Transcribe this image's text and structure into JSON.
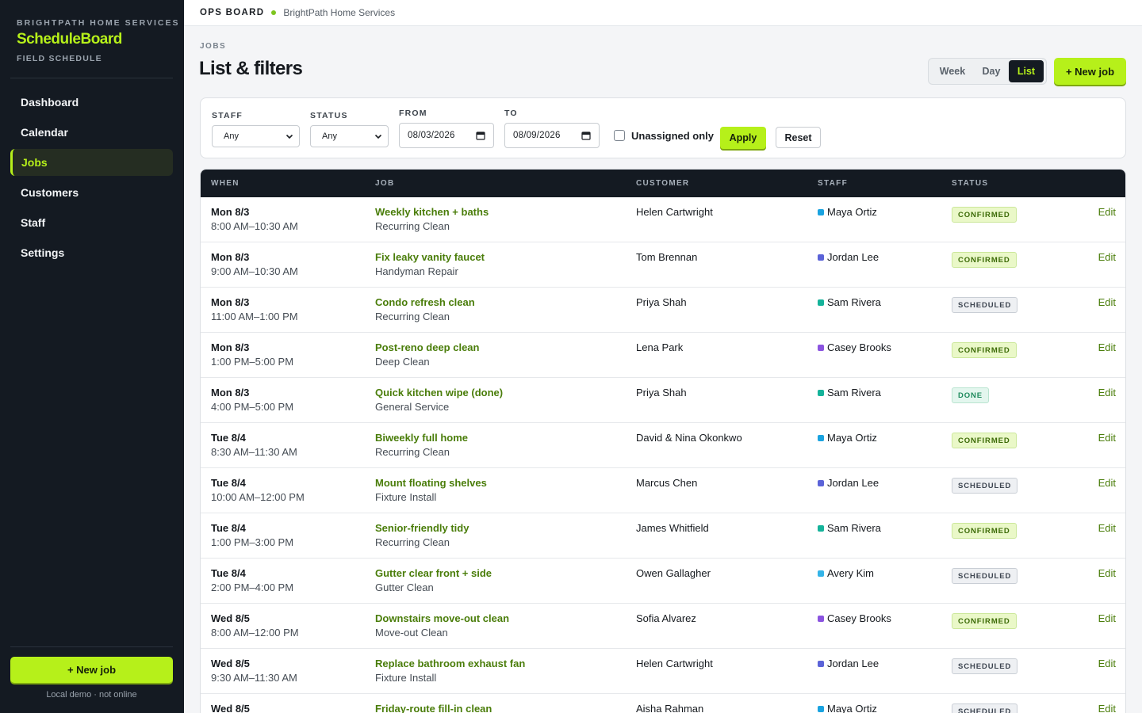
{
  "sidebar": {
    "company": "BRIGHTPATH HOME SERVICES",
    "app_name": "ScheduleBoard",
    "subtitle": "FIELD SCHEDULE",
    "nav": [
      {
        "label": "Dashboard",
        "active": false
      },
      {
        "label": "Calendar",
        "active": false
      },
      {
        "label": "Jobs",
        "active": true
      },
      {
        "label": "Customers",
        "active": false
      },
      {
        "label": "Staff",
        "active": false
      },
      {
        "label": "Settings",
        "active": false
      }
    ],
    "new_job_label": "+ New job",
    "footer": "Local demo · not online"
  },
  "topbar": {
    "title": "OPS BOARD",
    "org": "BrightPath Home Services"
  },
  "header": {
    "breadcrumb": "JOBS",
    "title": "List & filters",
    "views": [
      "Week",
      "Day",
      "List"
    ],
    "active_view": "List",
    "new_job_label": "+ New job"
  },
  "filters": {
    "staff_label": "STAFF",
    "staff_value": "Any",
    "status_label": "STATUS",
    "status_value": "Any",
    "from_label": "FROM",
    "from_value": "08/03/2026",
    "to_label": "TO",
    "to_value": "08/09/2026",
    "unassigned_label": "Unassigned only",
    "unassigned_checked": false,
    "apply_label": "Apply",
    "reset_label": "Reset"
  },
  "table": {
    "columns": [
      "WHEN",
      "JOB",
      "CUSTOMER",
      "STAFF",
      "STATUS"
    ],
    "edit_label": "Edit",
    "rows": [
      {
        "day": "Mon 8/3",
        "time": "8:00 AM–10:30 AM",
        "title": "Weekly kitchen + baths",
        "type": "Recurring Clean",
        "customer": "Helen Cartwright",
        "staff": "Maya Ortiz",
        "staff_color": "#1aa3e0",
        "status": "CONFIRMED",
        "status_kind": "confirmed"
      },
      {
        "day": "Mon 8/3",
        "time": "9:00 AM–10:30 AM",
        "title": "Fix leaky vanity faucet",
        "type": "Handyman Repair",
        "customer": "Tom Brennan",
        "staff": "Jordan Lee",
        "staff_color": "#5b63d8",
        "status": "CONFIRMED",
        "status_kind": "confirmed"
      },
      {
        "day": "Mon 8/3",
        "time": "11:00 AM–1:00 PM",
        "title": "Condo refresh clean",
        "type": "Recurring Clean",
        "customer": "Priya Shah",
        "staff": "Sam Rivera",
        "staff_color": "#15b39a",
        "status": "SCHEDULED",
        "status_kind": "scheduled"
      },
      {
        "day": "Mon 8/3",
        "time": "1:00 PM–5:00 PM",
        "title": "Post-reno deep clean",
        "type": "Deep Clean",
        "customer": "Lena Park",
        "staff": "Casey Brooks",
        "staff_color": "#8b54e0",
        "status": "CONFIRMED",
        "status_kind": "confirmed"
      },
      {
        "day": "Mon 8/3",
        "time": "4:00 PM–5:00 PM",
        "title": "Quick kitchen wipe (done)",
        "type": "General Service",
        "customer": "Priya Shah",
        "staff": "Sam Rivera",
        "staff_color": "#15b39a",
        "status": "DONE",
        "status_kind": "done"
      },
      {
        "day": "Tue 8/4",
        "time": "8:30 AM–11:30 AM",
        "title": "Biweekly full home",
        "type": "Recurring Clean",
        "customer": "David & Nina Okonkwo",
        "staff": "Maya Ortiz",
        "staff_color": "#1aa3e0",
        "status": "CONFIRMED",
        "status_kind": "confirmed"
      },
      {
        "day": "Tue 8/4",
        "time": "10:00 AM–12:00 PM",
        "title": "Mount floating shelves",
        "type": "Fixture Install",
        "customer": "Marcus Chen",
        "staff": "Jordan Lee",
        "staff_color": "#5b63d8",
        "status": "SCHEDULED",
        "status_kind": "scheduled"
      },
      {
        "day": "Tue 8/4",
        "time": "1:00 PM–3:00 PM",
        "title": "Senior-friendly tidy",
        "type": "Recurring Clean",
        "customer": "James Whitfield",
        "staff": "Sam Rivera",
        "staff_color": "#15b39a",
        "status": "CONFIRMED",
        "status_kind": "confirmed"
      },
      {
        "day": "Tue 8/4",
        "time": "2:00 PM–4:00 PM",
        "title": "Gutter clear front + side",
        "type": "Gutter Clean",
        "customer": "Owen Gallagher",
        "staff": "Avery Kim",
        "staff_color": "#34b4e8",
        "status": "SCHEDULED",
        "status_kind": "scheduled"
      },
      {
        "day": "Wed 8/5",
        "time": "8:00 AM–12:00 PM",
        "title": "Downstairs move-out clean",
        "type": "Move-out Clean",
        "customer": "Sofia Alvarez",
        "staff": "Casey Brooks",
        "staff_color": "#8b54e0",
        "status": "CONFIRMED",
        "status_kind": "confirmed"
      },
      {
        "day": "Wed 8/5",
        "time": "9:30 AM–11:30 AM",
        "title": "Replace bathroom exhaust fan",
        "type": "Fixture Install",
        "customer": "Helen Cartwright",
        "staff": "Jordan Lee",
        "staff_color": "#5b63d8",
        "status": "SCHEDULED",
        "status_kind": "scheduled"
      },
      {
        "day": "Wed 8/5",
        "time": "",
        "title": "Friday-route fill-in clean",
        "type": "",
        "customer": "Aisha Rahman",
        "staff": "Maya Ortiz",
        "staff_color": "#1aa3e0",
        "status": "SCHEDULED",
        "status_kind": "scheduled"
      }
    ]
  }
}
